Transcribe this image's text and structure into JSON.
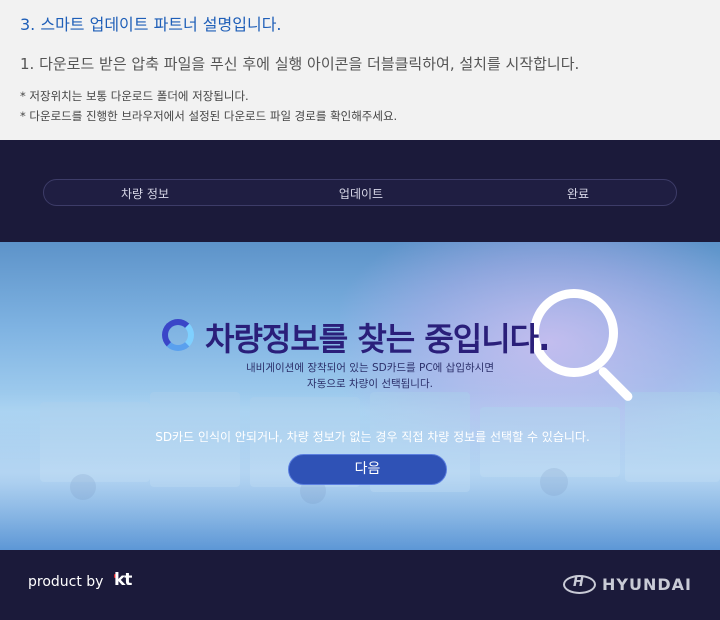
{
  "instructions": {
    "title": "3. 스마트 업데이트 파트너 설명입니다.",
    "step": "1. 다운로드 받은 압축 파일을 푸신 후에 실행 아이콘을 더블클릭하여, 설치를 시작합니다.",
    "notes": [
      "* 저장위치는 보통 다운로드 폴더에 저장됩니다.",
      "* 다운로드를 진행한 브라우저에서 설정된 다운로드 파일 경로를 확인해주세요."
    ]
  },
  "stepper": {
    "steps": [
      "차량 정보",
      "업데이트",
      "완료"
    ]
  },
  "hero": {
    "title": "차량정보를 찾는 중입니다.",
    "description": [
      "내비게이션에 장착되어 있는 SD카드를 PC에 삽입하시면",
      "자동으로 차량이 선택됩니다."
    ],
    "notice": "SD카드 인식이 안되거나, 차량 정보가 없는 경우 직접 차량 정보를 선택할 수 있습니다.",
    "next_label": "다음"
  },
  "footer": {
    "product_by": "product by",
    "partner_logo": "kt",
    "brand": "HYUNDAI"
  },
  "colors": {
    "accent": "#1f5fb8",
    "app_background": "#1b1a3a",
    "button": "#2f52b6",
    "kt_red": "#e3262f"
  },
  "icons": [
    "loading-spinner-icon",
    "magnifier-icon",
    "hyundai-emblem-icon"
  ]
}
